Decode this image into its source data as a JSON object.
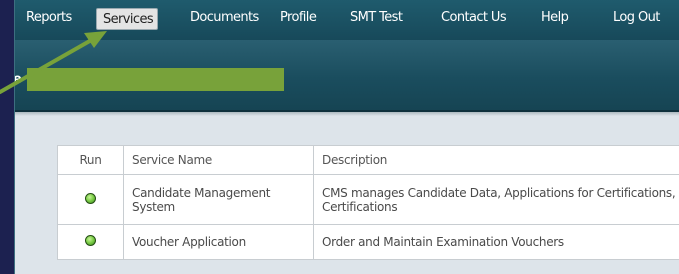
{
  "nav": {
    "items": [
      {
        "label": "Reports"
      },
      {
        "label": "Services"
      },
      {
        "label": "Documents"
      },
      {
        "label": "Profile"
      },
      {
        "label": "SMT Test"
      },
      {
        "label": "Contact Us"
      },
      {
        "label": "Help"
      },
      {
        "label": "Log Out"
      }
    ],
    "active": "Services"
  },
  "header": {
    "partial_text": "e"
  },
  "table": {
    "headers": [
      "Run",
      "Service Name",
      "Description"
    ],
    "rows": [
      {
        "service": "Candidate Management System",
        "description": "CMS manages Candidate Data, Applications for Certifications, Certifications",
        "status": "running"
      },
      {
        "service": "Voucher Application",
        "description": "Order and Maintain Examination Vouchers",
        "status": "running"
      }
    ]
  },
  "colors": {
    "nav_bg": "#1f5b6d",
    "active_tab_bg": "#e4e4e4",
    "annotation_arrow": "#78a23a",
    "redaction": "#78a23a",
    "status_green": "#7fd04a"
  }
}
